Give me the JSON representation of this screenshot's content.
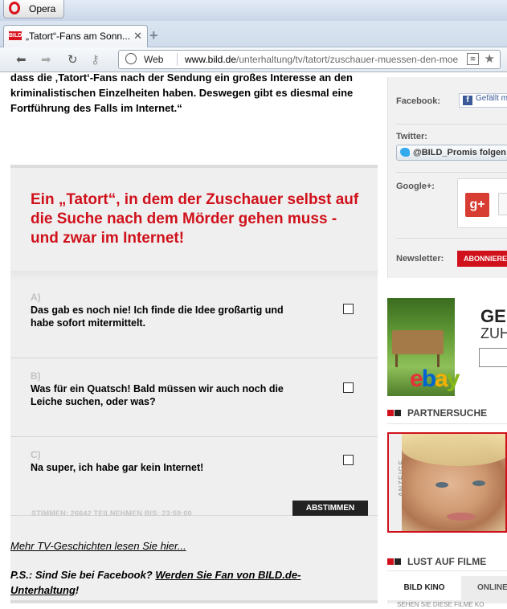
{
  "browser": {
    "menu_label": "Opera",
    "tab_title": "„Tatort“-Fans am Sonn...",
    "address_label": "Web",
    "url_domain": "www.bild.de",
    "url_path": "/unterhaltung/tv/tatort/zuschauer-muessen-den-moe",
    "tab_favicon": "BILD"
  },
  "article": {
    "intro": "dass die ‚Tatort‘-Fans nach der Sendung ein großes Interesse an den kriminalistischen Einzelheiten haben. Deswegen gibt es diesmal eine Fortführung des Falls im Internet.“"
  },
  "poll": {
    "question": "Ein „Tatort“, in dem der Zuschauer selbst auf die Suche nach dem Mörder gehen muss - und zwar im Internet!",
    "answers": [
      {
        "letter": "A)",
        "text": "Das gab es noch nie! Ich finde die Idee großartig und habe sofort mitermittelt."
      },
      {
        "letter": "B)",
        "text": "Was für ein Quatsch! Bald müssen wir auch noch die Leiche suchen, oder was?"
      },
      {
        "letter": "C)",
        "text": "Na super, ich habe gar kein Internet!"
      }
    ],
    "footer": "STIMMEN: 26642 TEILNEHMEN BIS: 23:59:00",
    "vote_label": "ABSTIMMEN"
  },
  "links": {
    "more": "Mehr TV-Geschichten lesen Sie hier...",
    "ps_prefix": "P.S.: Sind Sie bei Facebook? ",
    "ps_link": "Werden Sie Fan von BILD.de-Unterhaltung",
    "ps_suffix": "!"
  },
  "sidebar": {
    "facebook_label": "Facebook:",
    "facebook_button": "Gefällt mir",
    "twitter_label": "Twitter:",
    "twitter_button": "@BILD_Promis folgen",
    "gplus_label": "Google+:",
    "gplus_icon": "g+",
    "newsletter_label": "Newsletter:",
    "newsletter_button": "ABONNIEREN",
    "ebay_headline1": "GE",
    "ebay_headline2": "ZUH",
    "partner_heading": "PARTNERSUCHE",
    "ad_label": "ANZEIGE",
    "films_heading": "LUST AUF FILME",
    "tab_active": "BILD KINO",
    "tab_other": "ONLINE",
    "tab_sub": "SEHEN SIE DIESE FILME KO"
  },
  "colors": {
    "brand_red": "#d0111b",
    "poll_bg": "#efefef"
  }
}
